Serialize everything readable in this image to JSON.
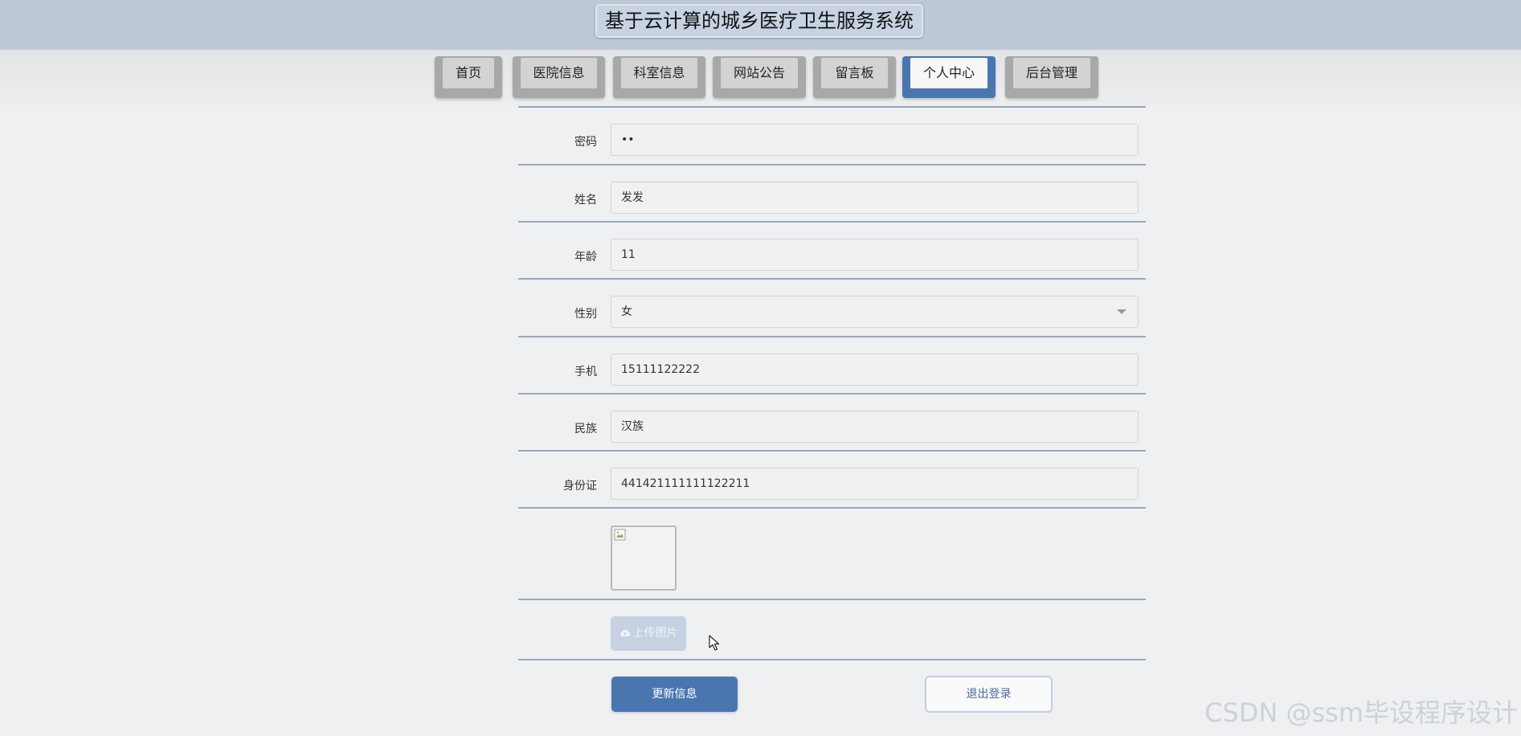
{
  "header": {
    "title": "基于云计算的城乡医疗卫生服务系统"
  },
  "nav": {
    "items": [
      {
        "label": "首页"
      },
      {
        "label": "医院信息"
      },
      {
        "label": "科室信息"
      },
      {
        "label": "网站公告"
      },
      {
        "label": "留言板"
      },
      {
        "label": "个人中心",
        "active": true
      },
      {
        "label": "后台管理"
      }
    ]
  },
  "form": {
    "fields": [
      {
        "label": "密码",
        "value": "••"
      },
      {
        "label": "姓名",
        "value": "发发"
      },
      {
        "label": "年龄",
        "value": "11"
      },
      {
        "label": "性别",
        "value": "女",
        "type": "select"
      },
      {
        "label": "手机",
        "value": "15111122222"
      },
      {
        "label": "民族",
        "value": "汉族"
      },
      {
        "label": "身份证",
        "value": "441421111111122211"
      }
    ],
    "upload_label": "上传图片",
    "update_label": "更新信息",
    "logout_label": "退出登录"
  },
  "watermark": "CSDN @ssm毕设程序设计",
  "colors": {
    "header_bg": "#bfc9d6",
    "accent": "#4a76b0",
    "nav_button": "#a8a8a8",
    "page_bg": "#eef0f2"
  },
  "icons": [
    "broken-image-icon",
    "cloud-upload-icon",
    "mouse-cursor-icon"
  ]
}
